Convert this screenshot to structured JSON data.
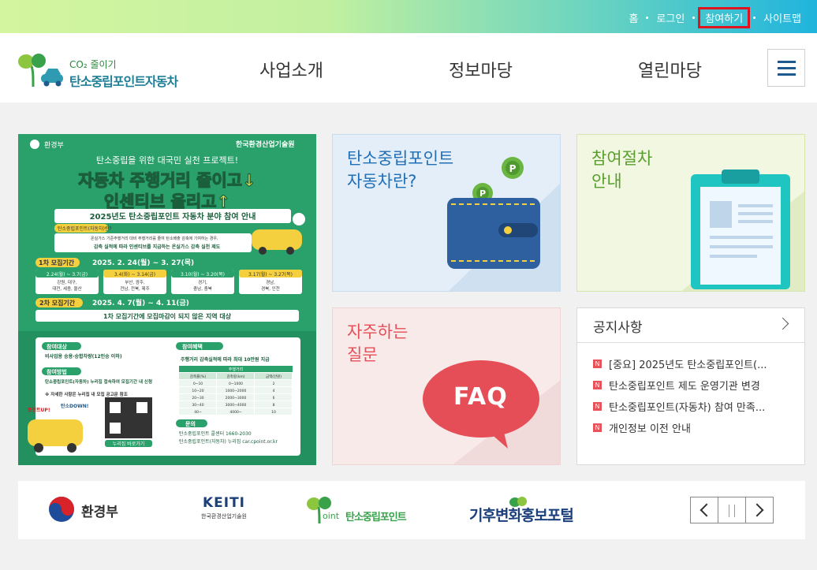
{
  "topnav": {
    "home": "홈",
    "login": "로그인",
    "join": "참여하기",
    "sitemap": "사이트맵"
  },
  "logo": {
    "sub": "CO₂ 줄이기",
    "main": "탄소중립포인트자동차"
  },
  "menu": [
    "사업소개",
    "정보마당",
    "열린마당"
  ],
  "poster": {
    "ministry": "환경부",
    "org": "한국환경산업기술원",
    "tagline": "탄소중립을 위한 대국민 실천 프로젝트!",
    "headline1": "자동차 주행거리 줄이고↓",
    "headline2": "인센티브 올리고↑",
    "banner": "2025년도 탄소중립포인트 자동차 분야 참여 안내",
    "badge": "탄소중립포인트(자동차)란?",
    "desc1": "온실가스 기준주행거리 대비 주행거리를 줄여 탄소배출 감축에 기여하는 경우,",
    "desc2": "감축 실적에 따라 인센티브를 지급하는 온실가스 감축 실천 제도",
    "round1_label": "1차 모집기간",
    "round1_dates": "2025. 2. 24(월) ~ 3. 27(목)",
    "slots": [
      {
        "date": "2.24(월) ~ 3.7(금)",
        "regions": "강원, 대구,\n대전, 세종, 울산"
      },
      {
        "date": "3.4(화) ~ 3.14(금)",
        "regions": "부산, 광주,\n전남, 전북, 제주"
      },
      {
        "date": "3.10(월) ~ 3.20(목)",
        "regions": "경기,\n충남, 충북"
      },
      {
        "date": "3.17(월) ~ 3.27(목)",
        "regions": "경남,\n경북, 인천"
      }
    ],
    "round2_label": "2차 모집기간",
    "round2_dates": "2025. 4. 7(월) ~ 4. 11(금)",
    "round2_note": "1차 모집기간에 모집마감이 되지 않은 지역 대상",
    "target_label": "참여대상",
    "target_text": "비사업용 승용·승합차량(12인승 이하)",
    "method_label": "참여방법",
    "method_text": "탄소중립포인트(자동차) 누리집 접속하여 모집기간 내 신청",
    "method_note": "※ 자세한 사항은 누리집 내 모집 공고문 참조",
    "benefit_label": "참여혜택",
    "benefit_text": "주행거리 감축실적에 따라 최대 10만원 지급",
    "table_header": "주행거리",
    "table_cols": [
      "감축률(%)",
      "감축량(km)",
      "금액(만원)"
    ],
    "table_rows": [
      [
        "0~10",
        "0~1000",
        "2"
      ],
      [
        "10~20",
        "1000~2000",
        "4"
      ],
      [
        "20~30",
        "2000~3000",
        "6"
      ],
      [
        "30~40",
        "3000~4000",
        "8"
      ],
      [
        "40~",
        "4000~",
        "10"
      ]
    ],
    "contact_label": "문의",
    "contact1": "탄소중립포인트 콜센터 1660-2030",
    "contact2": "탄소중립포인트(자동차) 누리집 car.cpoint.or.kr",
    "qr_label": "누리집 바로가기",
    "car_up": "포인트UP!",
    "car_down": "탄소DOWN!"
  },
  "cards": {
    "about": "탄소중립포인트\n자동차란?",
    "procedure": "참여절차\n안내",
    "faq": "자주하는\n질문",
    "faq_bubble": "FAQ"
  },
  "notice": {
    "title": "공지사항",
    "badge": "N",
    "items": [
      "[중요] 2025년도 탄소중립포인트(...",
      "탄소중립포인트 제도 운영기관 변경",
      "탄소중립포인트(자동차) 참여 만족...",
      "개인정보 이전 안내"
    ]
  },
  "partners": {
    "moe": "환경부",
    "keiti": "KEITI",
    "keiti_sub": "한국환경산업기술원",
    "cpoint": "탄소중립포인트",
    "cpoint_prefix": "oint",
    "climate": "기후변화홍보포털"
  },
  "colors": {
    "accent_red": "#e0141e",
    "green": "#2aa06b",
    "teal": "#1e7f96",
    "faq_red": "#e64e57"
  }
}
